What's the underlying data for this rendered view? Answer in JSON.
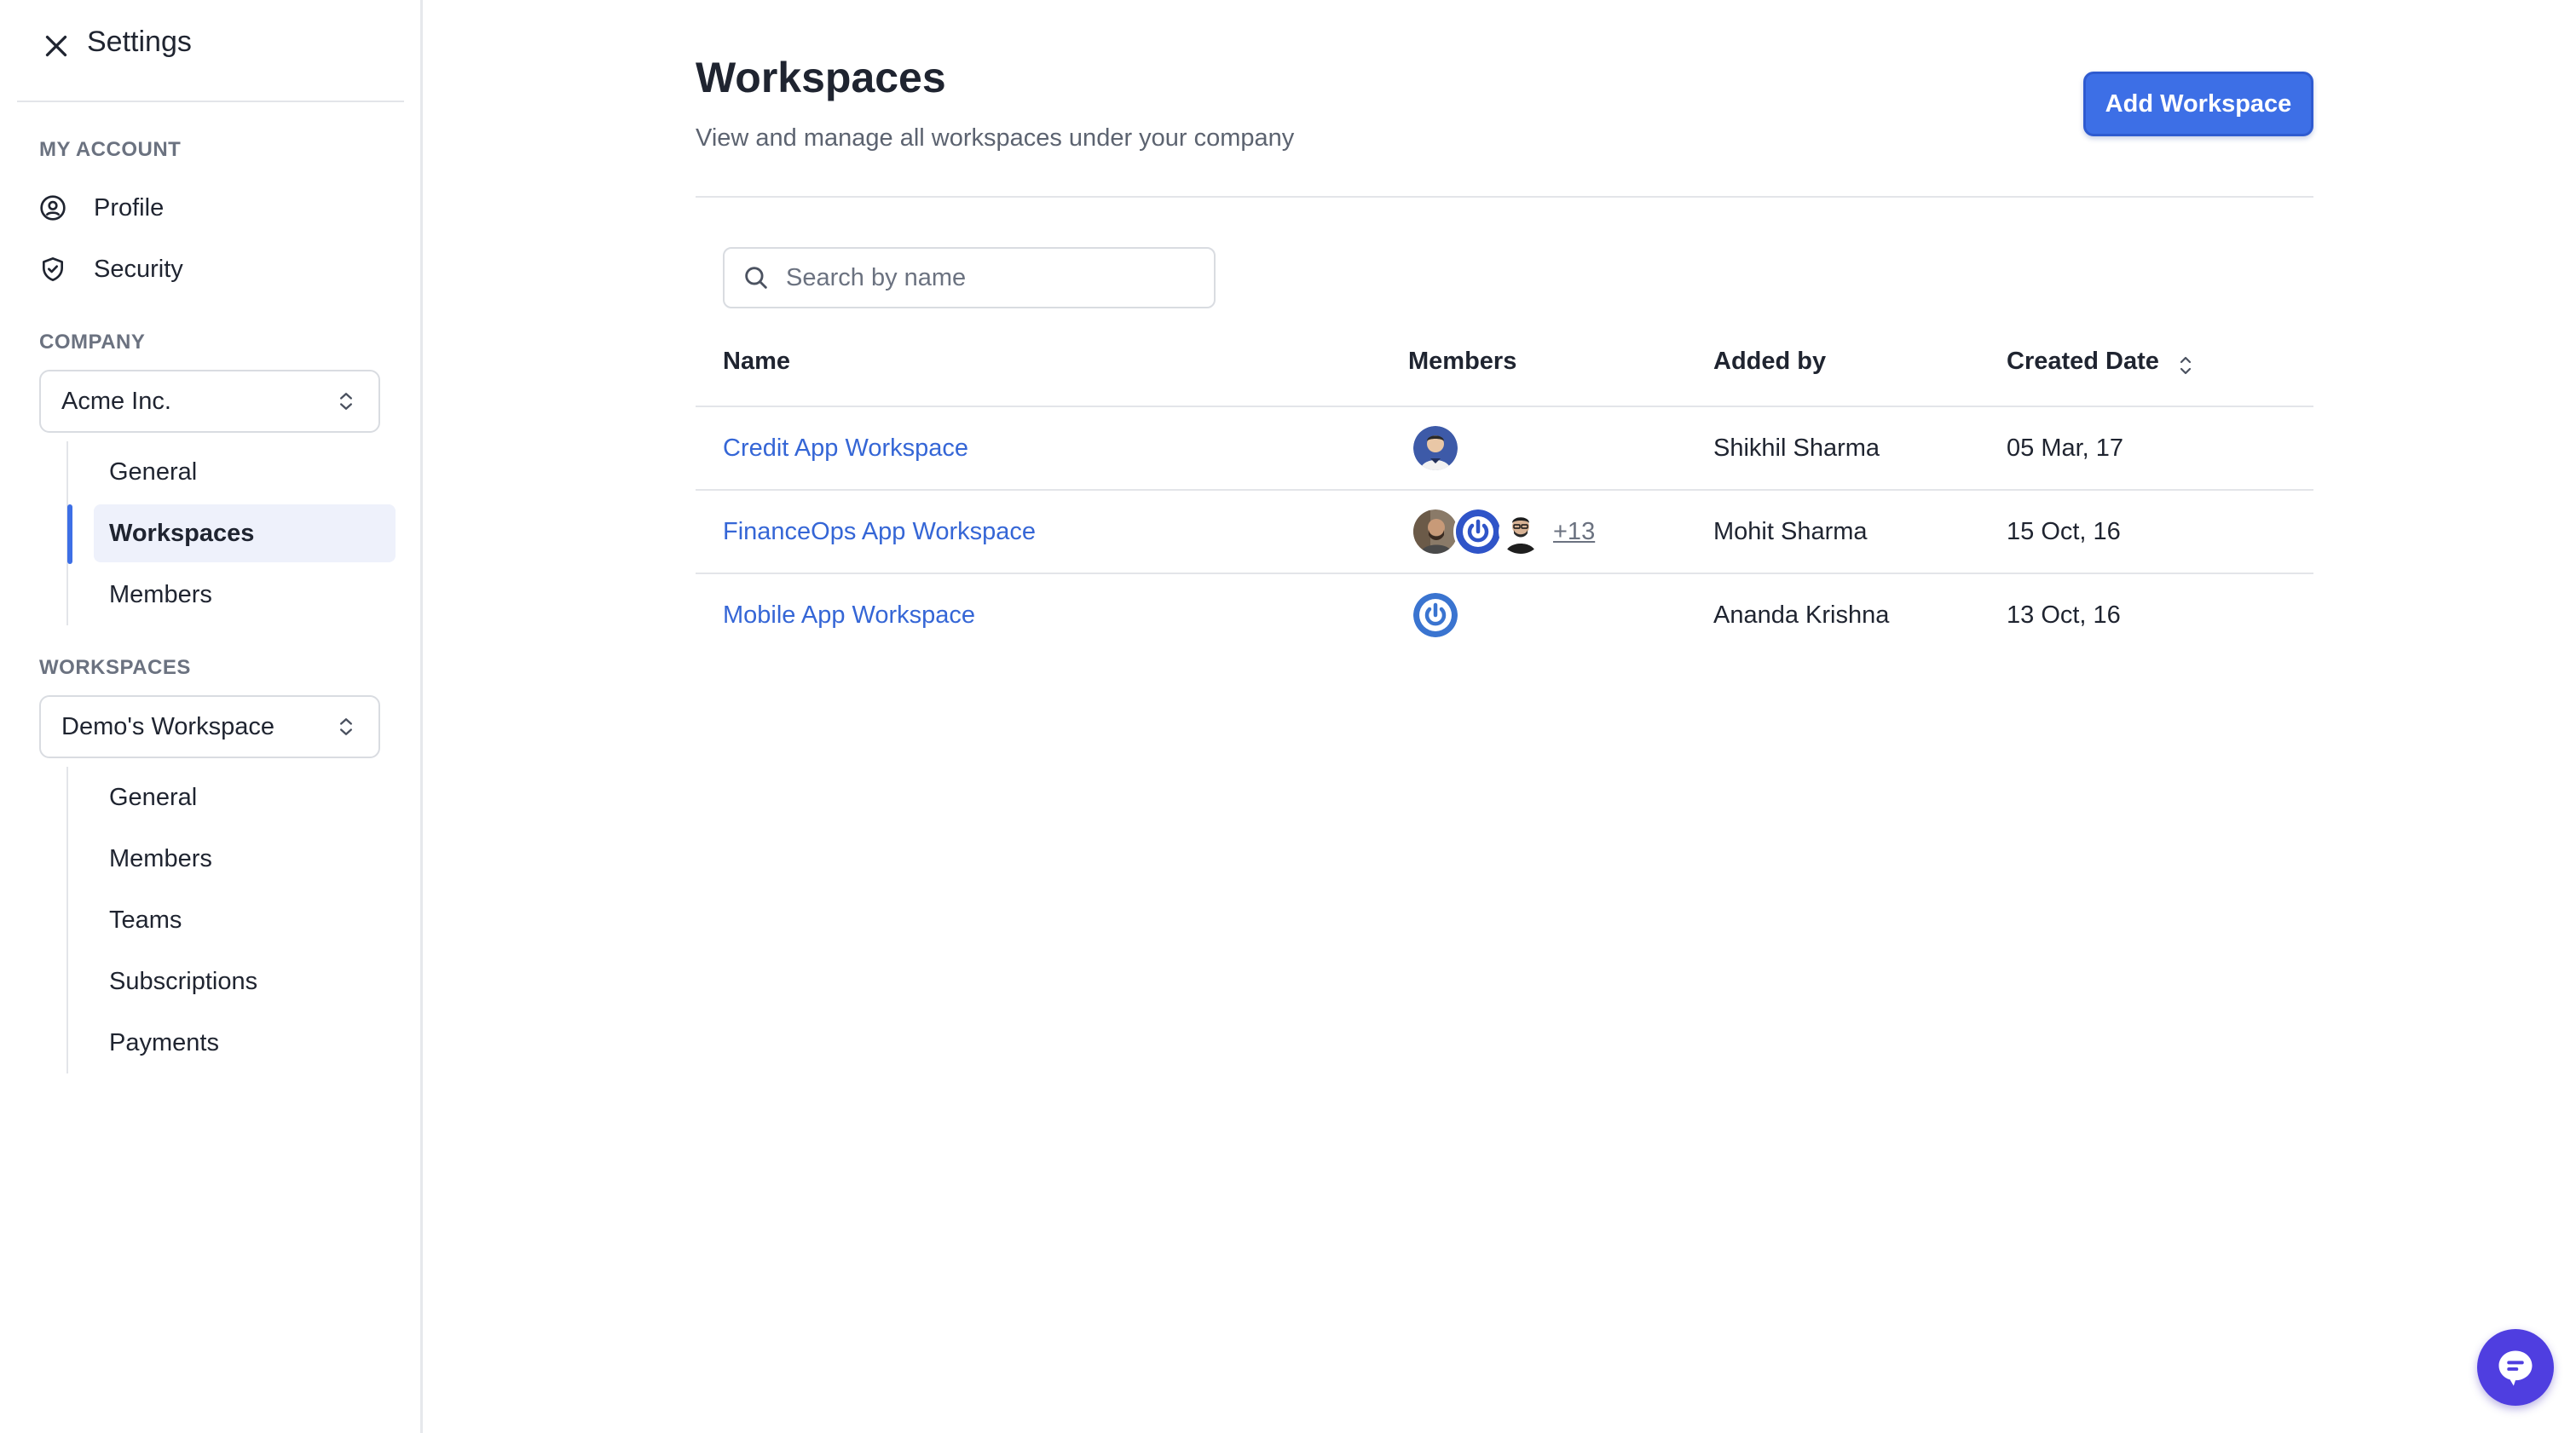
{
  "sidebar": {
    "title": "Settings",
    "my_account": {
      "label": "MY ACCOUNT",
      "items": [
        {
          "label": "Profile",
          "icon": "user-circle-icon"
        },
        {
          "label": "Security",
          "icon": "shield-check-icon"
        }
      ]
    },
    "company": {
      "label": "COMPANY",
      "selected": "Acme Inc.",
      "items": [
        "General",
        "Workspaces",
        "Members"
      ],
      "active": "Workspaces"
    },
    "workspaces": {
      "label": "WORKSPACES",
      "selected": "Demo's Workspace",
      "items": [
        "General",
        "Members",
        "Teams",
        "Subscriptions",
        "Payments"
      ]
    }
  },
  "main": {
    "title": "Workspaces",
    "subtitle": "View and manage all workspaces under your company",
    "add_button": "Add Workspace",
    "search": {
      "placeholder": "Search by name",
      "value": ""
    },
    "table": {
      "columns": [
        "Name",
        "Members",
        "Added by",
        "Created Date"
      ],
      "sorted_column": "Created Date",
      "rows": [
        {
          "name": "Credit App Workspace",
          "members": [
            "avatar-photo-man-blue"
          ],
          "more": "",
          "added_by": "Shikhil Sharma",
          "created": "05 Mar, 17"
        },
        {
          "name": "FinanceOps App Workspace",
          "members": [
            "avatar-photo-man-beard",
            "avatar-power-logo",
            "avatar-photo-man-glasses"
          ],
          "more": "+13",
          "added_by": "Mohit Sharma",
          "created": "15 Oct, 16"
        },
        {
          "name": "Mobile App Workspace",
          "members": [
            "avatar-power-logo"
          ],
          "more": "",
          "added_by": "Ananda Krishna",
          "created": "13 Oct, 16"
        }
      ]
    }
  },
  "colors": {
    "accent": "#3d6fe6",
    "link": "#3566d6",
    "chat": "#4f3ee0",
    "active_bg": "#eef1fb"
  },
  "chat_widget": {
    "icon": "chat-bubble-icon"
  }
}
